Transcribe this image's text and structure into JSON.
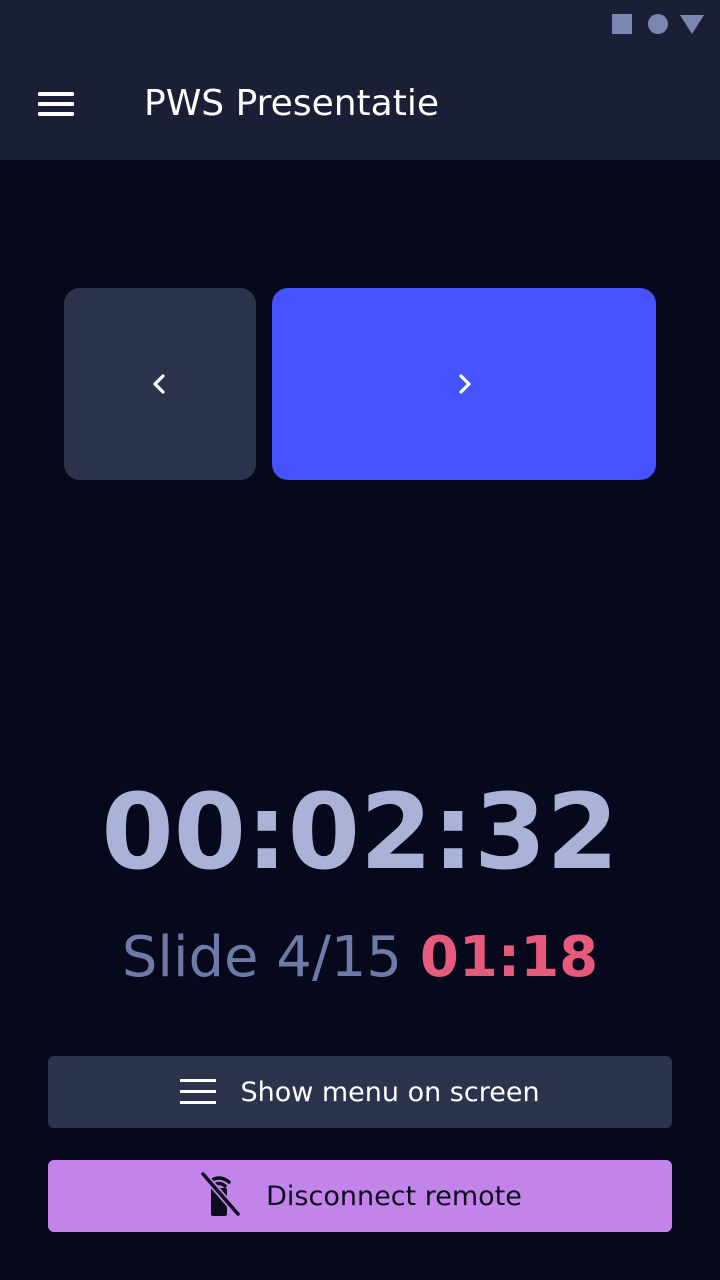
{
  "status_bar": {
    "icons": [
      "stop-square-icon",
      "circle-icon",
      "signal-triangle-icon"
    ]
  },
  "app_bar": {
    "title": "PWS Presentatie",
    "menu_icon": "hamburger-menu-icon"
  },
  "navigation": {
    "previous_icon": "chevron-left-icon",
    "next_icon": "chevron-right-icon"
  },
  "timer": {
    "total_elapsed": "00:02:32"
  },
  "slide": {
    "label": "Slide 4/15",
    "time": "01:18"
  },
  "actions": {
    "show_menu_label": "Show menu on screen",
    "show_menu_icon": "list-icon",
    "disconnect_label": "Disconnect remote",
    "disconnect_icon": "remote-off-icon"
  },
  "colors": {
    "background": "#06081c",
    "app_bar": "#1a1f36",
    "next_button": "#4552ff",
    "prev_button": "#2c344d",
    "disconnect_button": "#c284eb",
    "slide_time": "#e85a7c",
    "timer_text": "#aab3d7"
  }
}
